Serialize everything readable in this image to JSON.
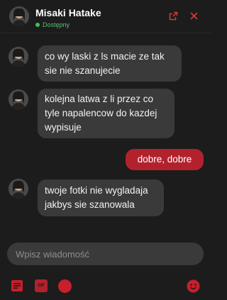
{
  "header": {
    "name": "Misaki Hatake",
    "status": "Dostępny",
    "status_color": "#3fbf5a",
    "popout_icon": "external-link-icon",
    "close_icon": "close-icon"
  },
  "messages": [
    {
      "direction": "incoming",
      "text": "co wy laski z ls macie ze tak\nsie nie szanujecie"
    },
    {
      "direction": "incoming",
      "text": "kolejna latwa z li przez co\ntyle napalencow do kazdej\nwypisuje"
    },
    {
      "direction": "outgoing",
      "text": "dobre, dobre"
    },
    {
      "direction": "incoming",
      "text": "twoje fotki nie wygladaja\njakbys sie szanowala"
    }
  ],
  "composer": {
    "placeholder": "Wpisz wiadomość",
    "gif_label": "GIF",
    "tools": [
      "sticker-icon",
      "gif-icon",
      "record-icon",
      "emoji-icon"
    ]
  },
  "colors": {
    "background": "#1c1c1c",
    "incoming_bubble": "#3a3a3a",
    "outgoing_bubble": "#b2222d",
    "accent": "#c81f2a"
  }
}
